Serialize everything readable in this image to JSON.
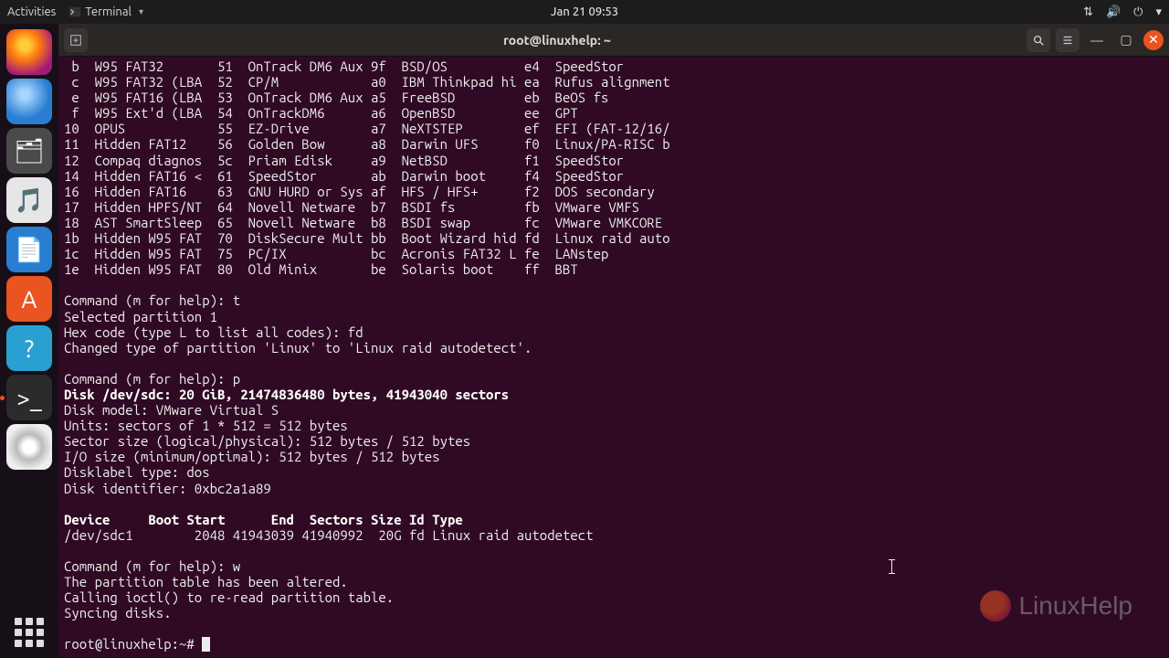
{
  "panel": {
    "activities": "Activities",
    "app_menu": "Terminal",
    "clock": "Jan 21  09:53"
  },
  "dock": {
    "items": [
      {
        "name": "firefox",
        "emoji": ""
      },
      {
        "name": "thunderbird",
        "emoji": ""
      },
      {
        "name": "files",
        "emoji": ""
      },
      {
        "name": "rhythmbox",
        "emoji": ""
      },
      {
        "name": "libreoffice-writer",
        "emoji": ""
      },
      {
        "name": "ubuntu-software",
        "emoji": "A"
      },
      {
        "name": "help",
        "emoji": "?"
      },
      {
        "name": "terminal",
        "emoji": ">_"
      },
      {
        "name": "dvd",
        "emoji": ""
      }
    ]
  },
  "window": {
    "title": "root@linuxhelp: ~"
  },
  "terminal": {
    "table_rows": [
      {
        "c1": " b",
        "c2": "W95 FAT32     ",
        "c3": "51",
        "c4": "OnTrack DM6 Aux",
        "c5": "9f",
        "c6": "BSD/OS         ",
        "c7": "e4",
        "c8": "SpeedStor"
      },
      {
        "c1": " c",
        "c2": "W95 FAT32 (LBA",
        "c3": "52",
        "c4": "CP/M           ",
        "c5": "a0",
        "c6": "IBM Thinkpad hi",
        "c7": "ea",
        "c8": "Rufus alignment"
      },
      {
        "c1": " e",
        "c2": "W95 FAT16 (LBA",
        "c3": "53",
        "c4": "OnTrack DM6 Aux",
        "c5": "a5",
        "c6": "FreeBSD        ",
        "c7": "eb",
        "c8": "BeOS fs"
      },
      {
        "c1": " f",
        "c2": "W95 Ext'd (LBA",
        "c3": "54",
        "c4": "OnTrackDM6     ",
        "c5": "a6",
        "c6": "OpenBSD        ",
        "c7": "ee",
        "c8": "GPT"
      },
      {
        "c1": "10",
        "c2": "OPUS          ",
        "c3": "55",
        "c4": "EZ-Drive       ",
        "c5": "a7",
        "c6": "NeXTSTEP       ",
        "c7": "ef",
        "c8": "EFI (FAT-12/16/"
      },
      {
        "c1": "11",
        "c2": "Hidden FAT12  ",
        "c3": "56",
        "c4": "Golden Bow     ",
        "c5": "a8",
        "c6": "Darwin UFS     ",
        "c7": "f0",
        "c8": "Linux/PA-RISC b"
      },
      {
        "c1": "12",
        "c2": "Compaq diagnos",
        "c3": "5c",
        "c4": "Priam Edisk    ",
        "c5": "a9",
        "c6": "NetBSD         ",
        "c7": "f1",
        "c8": "SpeedStor"
      },
      {
        "c1": "14",
        "c2": "Hidden FAT16 <",
        "c3": "61",
        "c4": "SpeedStor      ",
        "c5": "ab",
        "c6": "Darwin boot    ",
        "c7": "f4",
        "c8": "SpeedStor"
      },
      {
        "c1": "16",
        "c2": "Hidden FAT16  ",
        "c3": "63",
        "c4": "GNU HURD or Sys",
        "c5": "af",
        "c6": "HFS / HFS+     ",
        "c7": "f2",
        "c8": "DOS secondary"
      },
      {
        "c1": "17",
        "c2": "Hidden HPFS/NT",
        "c3": "64",
        "c4": "Novell Netware ",
        "c5": "b7",
        "c6": "BSDI fs        ",
        "c7": "fb",
        "c8": "VMware VMFS"
      },
      {
        "c1": "18",
        "c2": "AST SmartSleep",
        "c3": "65",
        "c4": "Novell Netware ",
        "c5": "b8",
        "c6": "BSDI swap      ",
        "c7": "fc",
        "c8": "VMware VMKCORE"
      },
      {
        "c1": "1b",
        "c2": "Hidden W95 FAT",
        "c3": "70",
        "c4": "DiskSecure Mult",
        "c5": "bb",
        "c6": "Boot Wizard hid",
        "c7": "fd",
        "c8": "Linux raid auto"
      },
      {
        "c1": "1c",
        "c2": "Hidden W95 FAT",
        "c3": "75",
        "c4": "PC/IX          ",
        "c5": "bc",
        "c6": "Acronis FAT32 L",
        "c7": "fe",
        "c8": "LANstep"
      },
      {
        "c1": "1e",
        "c2": "Hidden W95 FAT",
        "c3": "80",
        "c4": "Old Minix      ",
        "c5": "be",
        "c6": "Solaris boot   ",
        "c7": "ff",
        "c8": "BBT"
      }
    ],
    "lines": {
      "l1": "Command (m for help): t",
      "l2": "Selected partition 1",
      "l3": "Hex code (type L to list all codes): fd",
      "l4": "Changed type of partition 'Linux' to 'Linux raid autodetect'.",
      "l5": "Command (m for help): p",
      "l6": "Disk /dev/sdc: 20 GiB, 21474836480 bytes, 41943040 sectors",
      "l7": "Disk model: VMware Virtual S",
      "l8": "Units: sectors of 1 * 512 = 512 bytes",
      "l9": "Sector size (logical/physical): 512 bytes / 512 bytes",
      "l10": "I/O size (minimum/optimal): 512 bytes / 512 bytes",
      "l11": "Disklabel type: dos",
      "l12": "Disk identifier: 0xbc2a1a89",
      "l13": "Device     Boot Start      End  Sectors Size Id Type",
      "l14": "/dev/sdc1        2048 41943039 41940992  20G fd Linux raid autodetect",
      "l15": "Command (m for help): w",
      "l16": "The partition table has been altered.",
      "l17": "Calling ioctl() to re-read partition table.",
      "l18": "Syncing disks.",
      "prompt": "root@linuxhelp:~# "
    }
  },
  "watermark": "LinuxHelp"
}
